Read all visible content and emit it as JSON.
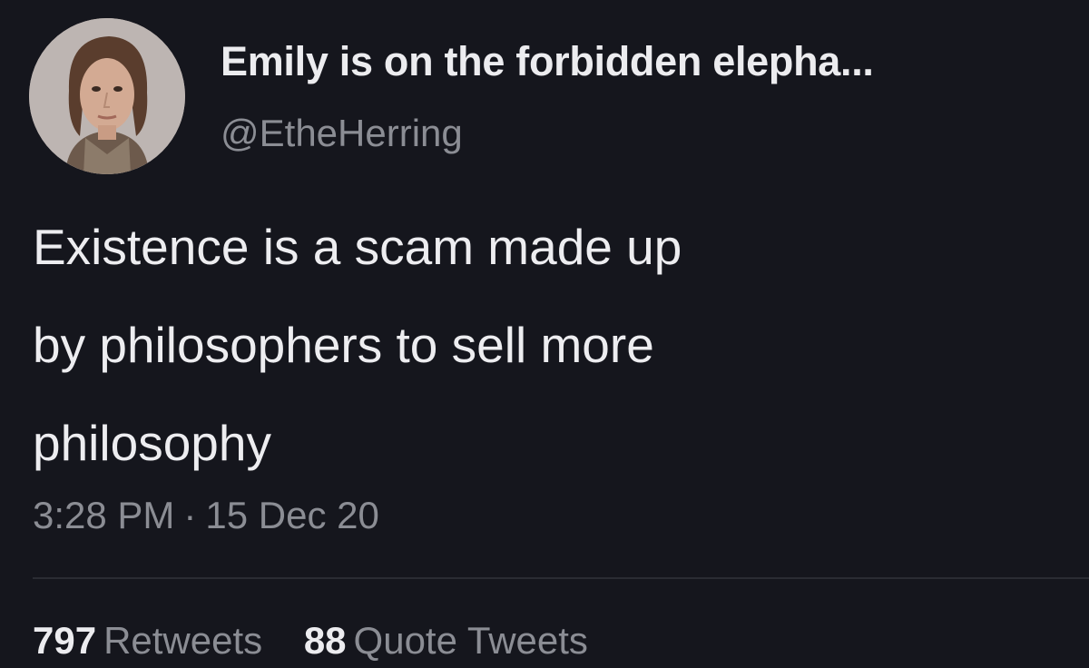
{
  "user": {
    "display_name": "Emily is on the forbidden elepha...",
    "handle": "@EtheHerring"
  },
  "tweet": {
    "lines": [
      "Existence is a scam made up",
      "by philosophers to sell more",
      "philosophy"
    ],
    "time": "3:28 PM",
    "separator": "·",
    "date": "15 Dec 20"
  },
  "stats": {
    "retweets_count": "797",
    "retweets_label": "Retweets",
    "quotes_count": "88",
    "quotes_label": "Quote Tweets"
  },
  "colors": {
    "background": "#15161d",
    "text": "#ececef",
    "muted": "#8b8d94",
    "divider": "#2a2c33"
  }
}
